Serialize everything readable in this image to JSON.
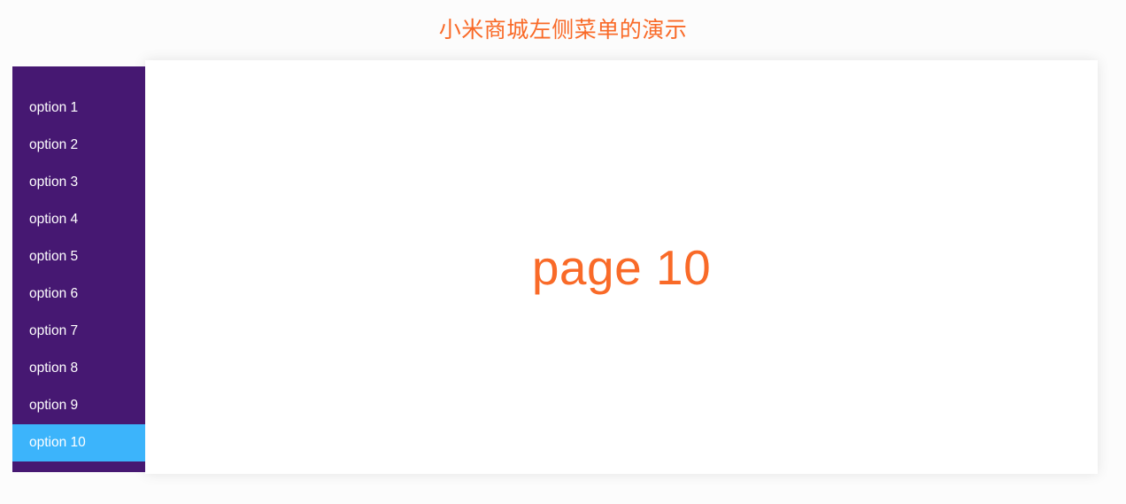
{
  "header": {
    "title": "小米商城左侧菜单的演示",
    "title_color": "#f96a28"
  },
  "sidebar": {
    "background_color": "#461872",
    "active_background_color": "#3cb4fb",
    "text_color": "#ffffff",
    "active_index": 9,
    "items": [
      {
        "label": "option 1",
        "active": false
      },
      {
        "label": "option 2",
        "active": false
      },
      {
        "label": "option 3",
        "active": false
      },
      {
        "label": "option 4",
        "active": false
      },
      {
        "label": "option 5",
        "active": false
      },
      {
        "label": "option 6",
        "active": false
      },
      {
        "label": "option 7",
        "active": false
      },
      {
        "label": "option 8",
        "active": false
      },
      {
        "label": "option 9",
        "active": false
      },
      {
        "label": "option 10",
        "active": true
      }
    ]
  },
  "main": {
    "page_label": "page 10",
    "page_label_color": "#f96a28",
    "background_color": "#ffffff"
  }
}
